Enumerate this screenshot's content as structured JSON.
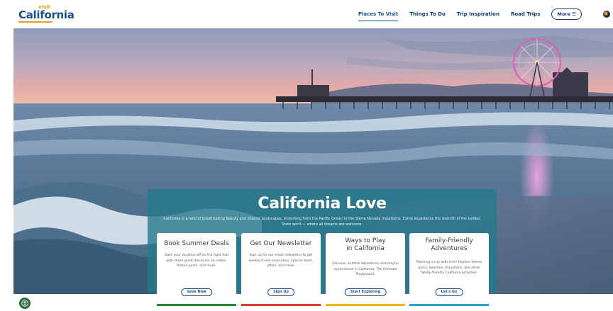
{
  "header": {
    "logo_small": "visit",
    "logo_main": "California",
    "nav": [
      {
        "label": "Places To Visit",
        "active": true
      },
      {
        "label": "Things To Do",
        "active": false
      },
      {
        "label": "Trip Inspiration",
        "active": false
      },
      {
        "label": "Road Trips",
        "active": false
      }
    ],
    "more_label": "More ☰"
  },
  "hero": {
    "title": "California Love",
    "description": "California is a land of breathtaking beauty and diverse landscapes, stretching from the Pacific Ocean to the Sierra Nevada mountains. Come experience the warmth of the Golden State spirit — where all dreams are welcome."
  },
  "cards": [
    {
      "title": "Book Summer Deals",
      "text": "Start your vacation off on the right foot with these great discounts on hotels, theme parks, and more.",
      "button": "Save Now",
      "accent": "#1f8a3a"
    },
    {
      "title": "Get Our Newsletter",
      "text": "Sign up for our email newsletter to get weekly travel inspiration, special deals, offers, and more.",
      "button": "Sign Up",
      "accent": "#d83a2c"
    },
    {
      "title": "Ways to Play in California",
      "text": "Discover endless adventures and playful experiences in California, The Ultimate Playground.",
      "button": "Start Exploring",
      "accent": "#f2b51e"
    },
    {
      "title": "Family-Friendly Adventures",
      "text": "Planning a trip with kids? Explore theme parks, beaches, mountains, and other family-friendly California activities.",
      "button": "Let's Go",
      "accent": "#2aa0c8"
    }
  ],
  "colors": {
    "brand_blue": "#123b6d",
    "brand_gold": "#e3a21a",
    "panel_teal": "#247a8c"
  },
  "icons": {
    "accessibility": "accessibility-icon",
    "user": "user-avatar-icon"
  }
}
